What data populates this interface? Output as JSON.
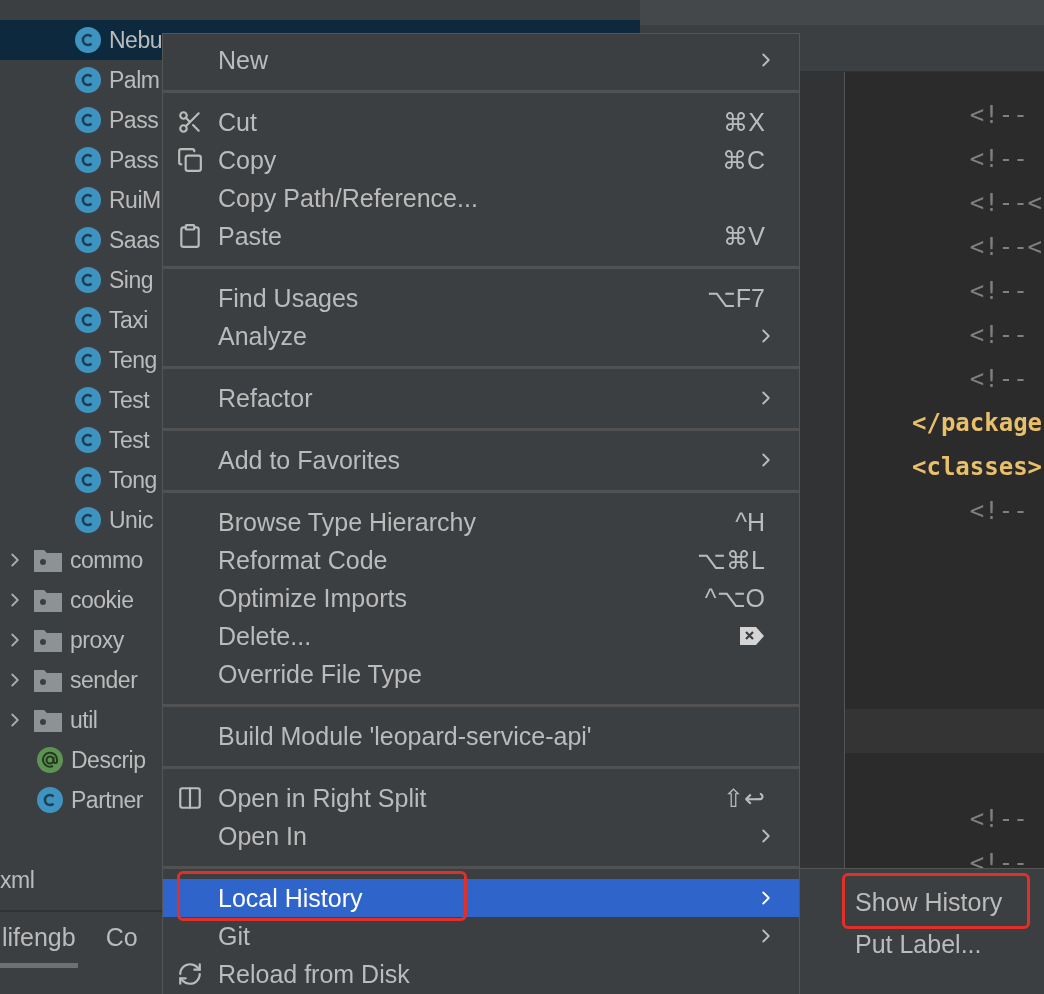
{
  "tree": {
    "items": [
      {
        "children": [
          {
            "children": [
              {
                "label": "Nebu",
                "kind": "class",
                "selected": true
              },
              {
                "label": "Palm",
                "kind": "class",
                "selected": false
              },
              {
                "label": "Pass",
                "kind": "class",
                "selected": false
              },
              {
                "label": "Pass",
                "kind": "class",
                "selected": false
              },
              {
                "label": "RuiM",
                "kind": "class",
                "selected": false
              },
              {
                "label": "Saas",
                "kind": "class",
                "selected": false
              },
              {
                "label": "Sing",
                "kind": "class",
                "selected": false
              },
              {
                "label": "Taxi",
                "kind": "class",
                "selected": false
              },
              {
                "label": "Teng",
                "kind": "class",
                "selected": false
              },
              {
                "label": "Test",
                "kind": "class",
                "selected": false
              },
              {
                "label": "Test",
                "kind": "class",
                "selected": false
              },
              {
                "label": "Tong",
                "kind": "class",
                "selected": false
              },
              {
                "label": "Unic",
                "kind": "class",
                "selected": false
              }
            ]
          },
          {
            "label": "commo",
            "kind": "folder",
            "selected": false,
            "expanded": false
          },
          {
            "label": "cookie",
            "kind": "folder",
            "selected": false,
            "expanded": false
          },
          {
            "label": "proxy",
            "kind": "folder",
            "selected": false,
            "expanded": false
          },
          {
            "label": "sender",
            "kind": "folder",
            "selected": false,
            "expanded": false
          },
          {
            "label": "util",
            "kind": "folder",
            "selected": false,
            "expanded": false
          },
          {
            "label": "Descrip",
            "kind": "annotation",
            "selected": false
          },
          {
            "label": "Partner",
            "kind": "class",
            "selected": false
          }
        ]
      },
      {
        "label": "xml",
        "selected": false
      }
    ]
  },
  "bottom_tabs": [
    {
      "label": "lifengb",
      "selected": true
    },
    {
      "label": "Co",
      "selected": false
    }
  ],
  "editor": {
    "lines": [
      {
        "kind": "comment",
        "text": "    <!--"
      },
      {
        "kind": "comment",
        "text": "    <!--"
      },
      {
        "kind": "comment",
        "text": "    <!--<"
      },
      {
        "kind": "comment",
        "text": "    <!--<"
      },
      {
        "kind": "comment",
        "text": "    <!--"
      },
      {
        "kind": "comment",
        "text": "    <!--"
      },
      {
        "kind": "comment",
        "text": "    <!--"
      },
      {
        "kind": "tag",
        "text": "</package"
      },
      {
        "kind": "tag",
        "text": "<classes>"
      },
      {
        "kind": "comment",
        "text": "    <!--"
      },
      {
        "kind": "blank"
      },
      {
        "kind": "blank"
      },
      {
        "kind": "blank"
      },
      {
        "kind": "blank"
      },
      {
        "kind": "current"
      },
      {
        "kind": "blank"
      },
      {
        "kind": "comment",
        "text": "    <!--"
      },
      {
        "kind": "comment",
        "text": "    <!--"
      }
    ]
  },
  "context_menu": {
    "items": [
      {
        "kind": "item",
        "label": "New",
        "submenu": true,
        "selected": false
      },
      {
        "kind": "separator"
      },
      {
        "kind": "item",
        "label": "Cut",
        "shortcut": "⌘X",
        "selected": false
      },
      {
        "kind": "item",
        "label": "Copy",
        "shortcut": "⌘C",
        "selected": false
      },
      {
        "kind": "item",
        "label": "Copy Path/Reference...",
        "selected": false
      },
      {
        "kind": "item",
        "label": "Paste",
        "shortcut": "⌘V",
        "selected": false
      },
      {
        "kind": "separator"
      },
      {
        "kind": "item",
        "label": "Find Usages",
        "shortcut": "⌥F7",
        "selected": false
      },
      {
        "kind": "item",
        "label": "Analyze",
        "submenu": true,
        "selected": false
      },
      {
        "kind": "separator"
      },
      {
        "kind": "item",
        "label": "Refactor",
        "submenu": true,
        "selected": false
      },
      {
        "kind": "separator"
      },
      {
        "kind": "item",
        "label": "Add to Favorites",
        "submenu": true,
        "selected": false
      },
      {
        "kind": "separator"
      },
      {
        "kind": "item",
        "label": "Browse Type Hierarchy",
        "shortcut": "^H",
        "selected": false
      },
      {
        "kind": "item",
        "label": "Reformat Code",
        "shortcut": "⌥⌘L",
        "selected": false
      },
      {
        "kind": "item",
        "label": "Optimize Imports",
        "shortcut": "^⌥O",
        "selected": false
      },
      {
        "kind": "item",
        "label": "Delete...",
        "selected": false
      },
      {
        "kind": "item",
        "label": "Override File Type",
        "selected": false
      },
      {
        "kind": "separator"
      },
      {
        "kind": "item",
        "label": "Build Module 'leopard-service-api'",
        "selected": false
      },
      {
        "kind": "separator"
      },
      {
        "kind": "item",
        "label": "Open in Right Split",
        "shortcut": "⇧↩",
        "selected": false
      },
      {
        "kind": "item",
        "label": "Open In",
        "submenu": true,
        "selected": false
      },
      {
        "kind": "separator"
      },
      {
        "kind": "item",
        "label": "Local History",
        "submenu": true,
        "selected": true,
        "annotated": true
      },
      {
        "kind": "item",
        "label": "Git",
        "submenu": true,
        "selected": false
      },
      {
        "kind": "item",
        "label": "Reload from Disk",
        "selected": false
      }
    ]
  },
  "submenu": {
    "items": [
      {
        "label": "Show History",
        "selected": false,
        "annotated": true
      },
      {
        "label": "Put Label...",
        "selected": false
      }
    ]
  }
}
